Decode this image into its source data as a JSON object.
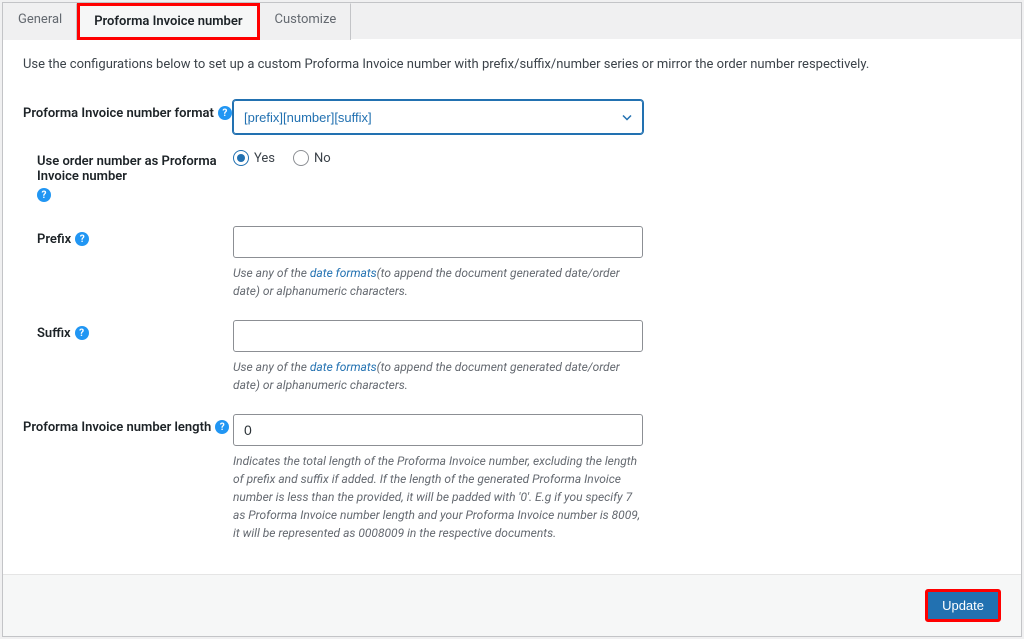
{
  "tabs": {
    "general": "General",
    "proforma": "Proforma Invoice number",
    "customize": "Customize"
  },
  "intro": "Use the configurations below to set up a custom Proforma Invoice number with prefix/suffix/number series or mirror the order number respectively.",
  "fields": {
    "format": {
      "label": "Proforma Invoice number format",
      "value": "[prefix][number][suffix]"
    },
    "use_order": {
      "label": "Use order number as Proforma Invoice number",
      "yes": "Yes",
      "no": "No"
    },
    "prefix": {
      "label": "Prefix",
      "value": "",
      "hint_pre": "Use any of the ",
      "hint_link": "date formats",
      "hint_post": "(to append the document generated date/order date) or alphanumeric characters."
    },
    "suffix": {
      "label": "Suffix",
      "value": "",
      "hint_pre": "Use any of the ",
      "hint_link": "date formats",
      "hint_post": "(to append the document generated date/order date) or alphanumeric characters."
    },
    "length": {
      "label": "Proforma Invoice number length",
      "value": "0",
      "hint": "Indicates the total length of the Proforma Invoice number, excluding the length of prefix and suffix if added. If the length of the generated Proforma Invoice number is less than the provided, it will be padded with '0'. E.g if you specify 7 as Proforma Invoice number length and your Proforma Invoice number is 8009, it will be represented as 0008009 in the respective documents."
    }
  },
  "buttons": {
    "update": "Update"
  }
}
